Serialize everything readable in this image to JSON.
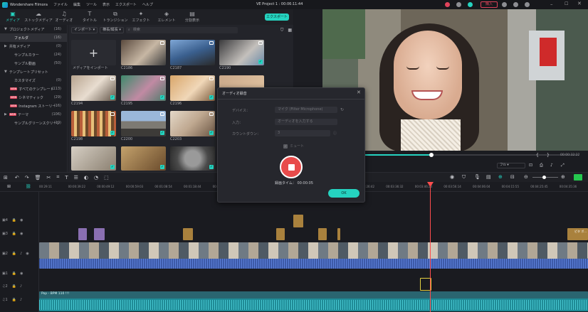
{
  "titlebar": {
    "app_name": "Wondershare Filmora",
    "menus": [
      "ファイル",
      "編集",
      "ツール",
      "表示",
      "エクスポート",
      "ヘルプ"
    ],
    "project_title": "VE Project 1 : 00:06:11:44",
    "buy_label": "購入"
  },
  "toolbar": {
    "tabs": [
      {
        "label": "メディア",
        "icon": "folder-icon",
        "active": true
      },
      {
        "label": "ストックメディア",
        "icon": "cloud-icon",
        "active": false
      },
      {
        "label": "オーディオ",
        "icon": "music-note-icon",
        "active": false
      },
      {
        "label": "タイトル",
        "icon": "text-icon",
        "active": false
      },
      {
        "label": "トランジション",
        "icon": "transition-icon",
        "active": false
      },
      {
        "label": "エフェクト",
        "icon": "effects-icon",
        "active": false
      },
      {
        "label": "エレメント",
        "icon": "elements-icon",
        "active": false
      },
      {
        "label": "分割表示",
        "icon": "split-screen-icon",
        "active": false
      }
    ],
    "export_label": "エクスポート"
  },
  "sidebar": {
    "items": [
      {
        "label": "プロジェクトメディア",
        "count": "(16)",
        "level": 0,
        "arrow": "▼",
        "selected": false
      },
      {
        "label": "フォルダ",
        "count": "(16)",
        "level": 1,
        "selected": true
      },
      {
        "label": "共有メディア",
        "count": "(0)",
        "level": 0,
        "arrow": "▶",
        "selected": false
      },
      {
        "label": "サンプルカラー",
        "count": "(24)",
        "level": 1,
        "selected": false
      },
      {
        "label": "サンプル動画",
        "count": "(50)",
        "level": 1,
        "selected": false
      },
      {
        "label": "テンプレートプリセット",
        "count": "",
        "level": 0,
        "arrow": "▼",
        "selected": false
      },
      {
        "label": "カスタマイズ",
        "count": "(0)",
        "level": 1,
        "selected": false
      },
      {
        "label": "すべてのテンプレート",
        "count": "(113)",
        "level": 1,
        "badge": "NEW",
        "selected": false
      },
      {
        "label": "シネマティック",
        "count": "(29)",
        "level": 1,
        "badge": "NEW",
        "selected": false
      },
      {
        "label": "Instagram ストーリー",
        "count": "(16)",
        "level": 1,
        "badge": "NEW",
        "selected": false
      },
      {
        "label": "テーマ",
        "count": "(106)",
        "level": 0,
        "arrow": "▶",
        "badge": "NEW",
        "selected": false
      },
      {
        "label": "サンプルグリーンスクリーン",
        "count": "(10)",
        "level": 1,
        "selected": false
      }
    ]
  },
  "media": {
    "import_label": "インポート",
    "sort_label": "横長/縦長",
    "search_placeholder": "検索",
    "import_tile_label": "メディアをインポート",
    "clips": [
      "C2186",
      "C2187",
      "C2190",
      "C2194",
      "C2195",
      "C2196",
      "C2198",
      "C2200",
      "C2203"
    ]
  },
  "preview": {
    "quality": "フル",
    "time": "00:00:32:22"
  },
  "timeline": {
    "ruler": [
      "00:29:11",
      "00:00:39:22",
      "00:00:49:12",
      "00:00:59:03",
      "00:01:08:54",
      "00:01:18:44",
      "00:01:28:35",
      "00:01:38:25",
      "00:01:48:16",
      "00:06:07:01",
      "00:03:16:51",
      "00:03:26:42",
      "00:03:36:32",
      "00:03:46:23",
      "00:03:56:14",
      "00:04:06:04",
      "00:04:15:55",
      "00:04:25:45",
      "00:04:35:36"
    ],
    "audio_label": "Pop - BPM 110 !!!",
    "clip_label": "ピタ ボ..."
  },
  "dialog": {
    "title": "オーディオ録音",
    "device_label": "デバイス：",
    "device_value": "マイク (Filter Microphone)",
    "input_label": "入力：",
    "input_value": "オーディオを入力する",
    "countdown_label": "カウントダウン：",
    "countdown_value": "3",
    "mute_label": "ミュート",
    "record_time_label": "録画タイム：",
    "record_time_value": "00:00:05",
    "ok_label": "OK"
  },
  "colors": {
    "accent": "#25d3c0",
    "record": "#e84b4b",
    "background": "#1b1c21"
  }
}
